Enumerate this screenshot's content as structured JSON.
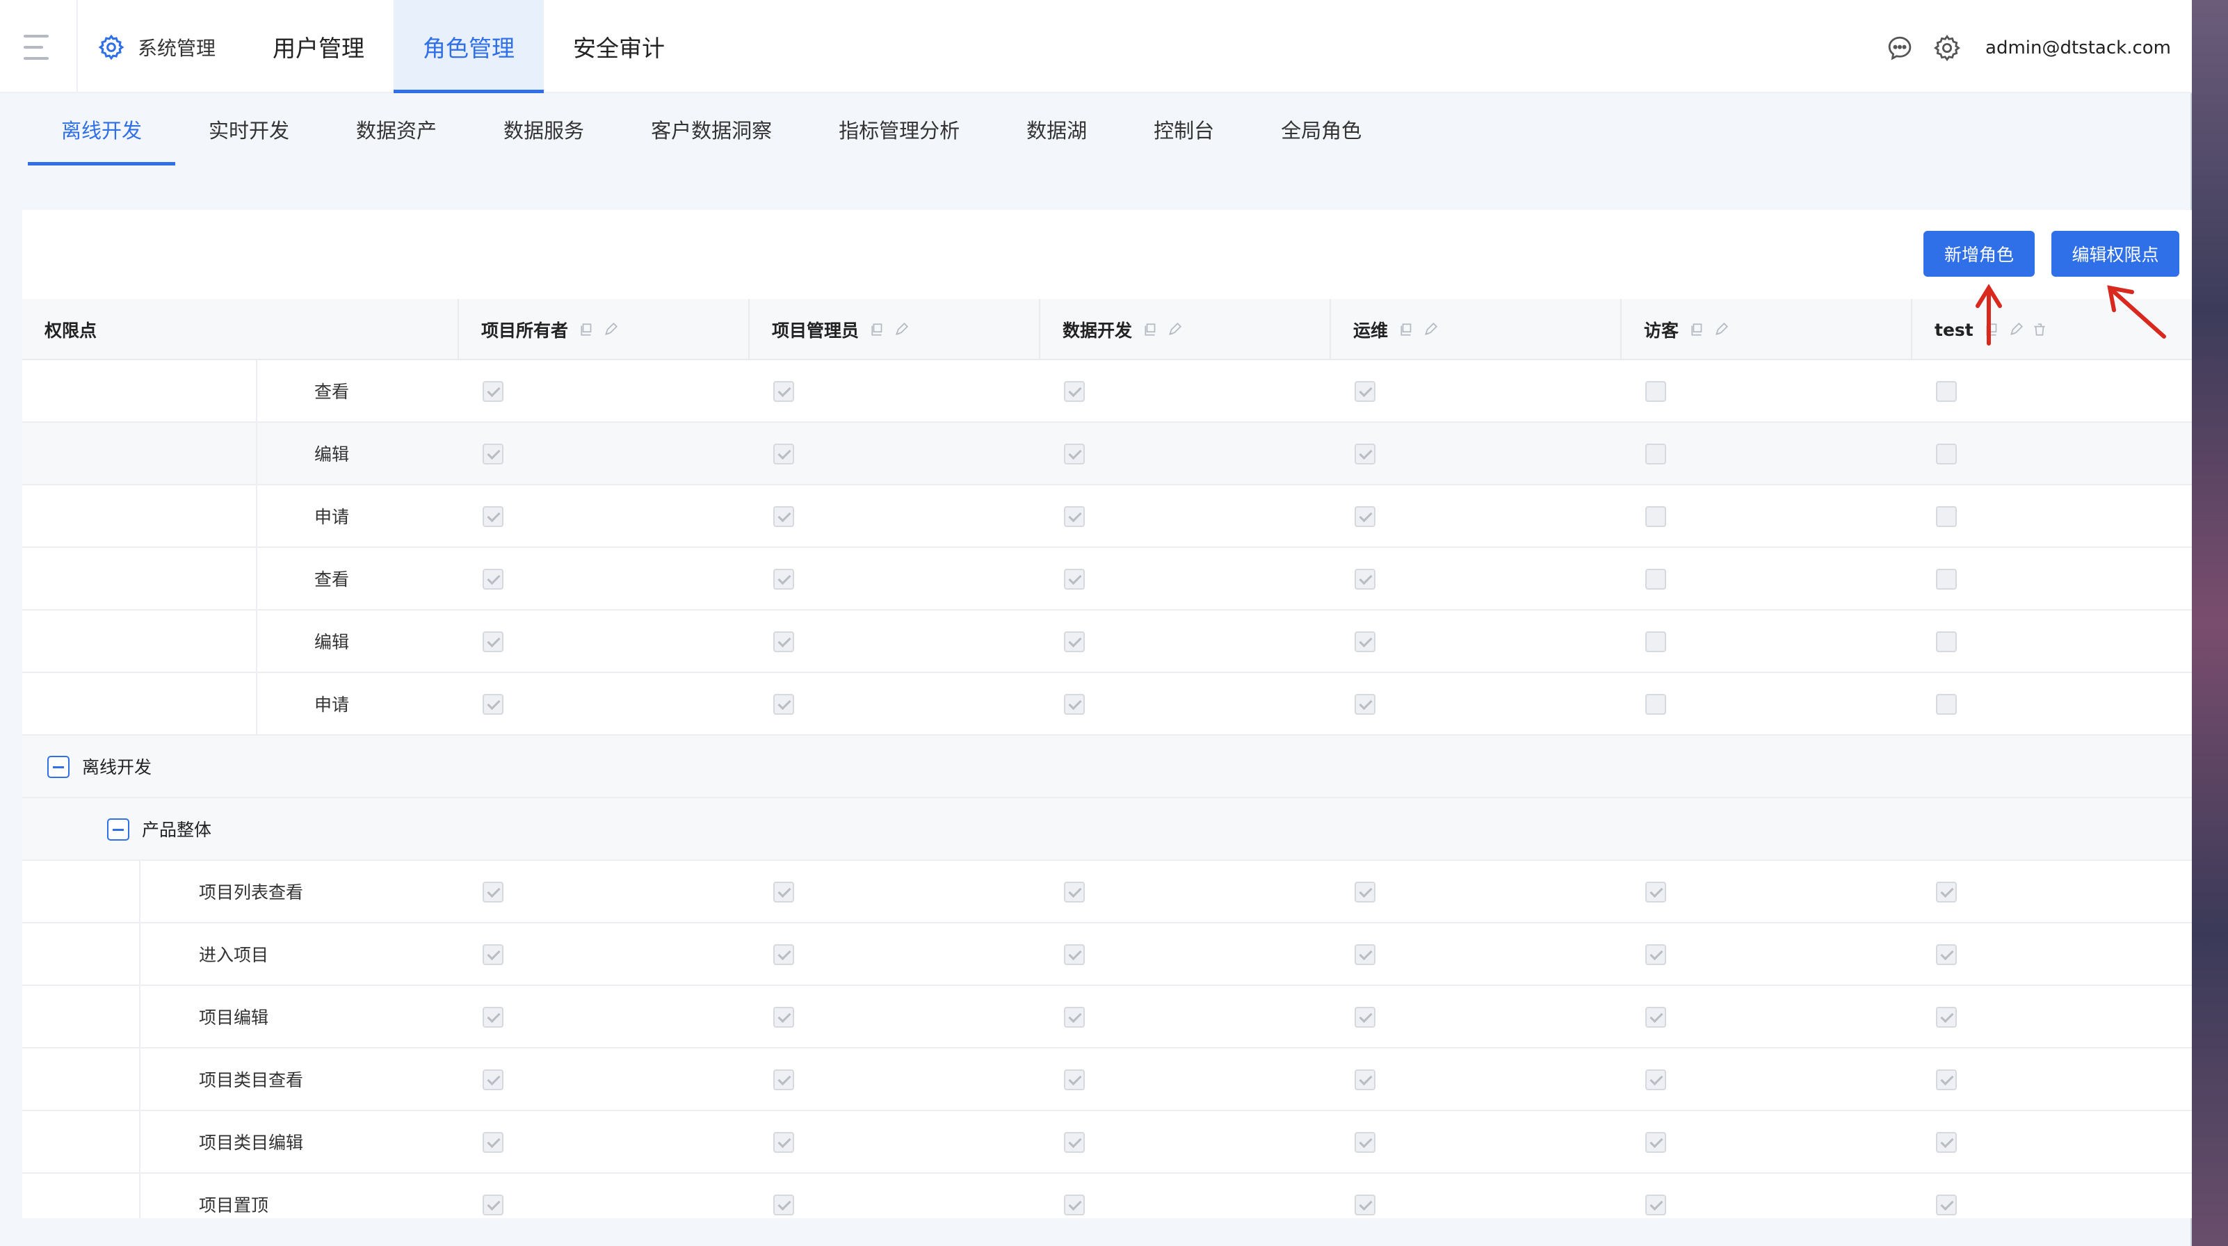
{
  "header": {
    "system_label": "系统管理",
    "nav": [
      "用户管理",
      "角色管理",
      "安全审计"
    ],
    "active_nav": 1,
    "user": "admin@dtstack.com"
  },
  "subtabs": {
    "items": [
      "离线开发",
      "实时开发",
      "数据资产",
      "数据服务",
      "客户数据洞察",
      "指标管理分析",
      "数据湖",
      "控制台",
      "全局角色"
    ],
    "active": 0
  },
  "toolbar": {
    "add_role": "新增角色",
    "edit_permissions": "编辑权限点"
  },
  "table": {
    "first_header": "权限点",
    "roles": [
      {
        "name": "项目所有者",
        "deletable": false
      },
      {
        "name": "项目管理员",
        "deletable": false
      },
      {
        "name": "数据开发",
        "deletable": false
      },
      {
        "name": "运维",
        "deletable": false
      },
      {
        "name": "访客",
        "deletable": false
      },
      {
        "name": "test",
        "deletable": true
      }
    ],
    "rows": [
      {
        "kind": "perm",
        "level": 3,
        "label": "查看",
        "checks": [
          true,
          true,
          true,
          true,
          false,
          false
        ],
        "alt": false
      },
      {
        "kind": "perm",
        "level": 3,
        "label": "编辑",
        "checks": [
          true,
          true,
          true,
          true,
          false,
          false
        ],
        "alt": true
      },
      {
        "kind": "perm",
        "level": 3,
        "label": "申请",
        "checks": [
          true,
          true,
          true,
          true,
          false,
          false
        ],
        "alt": false
      },
      {
        "kind": "perm",
        "level": 3,
        "label": "查看",
        "checks": [
          true,
          true,
          true,
          true,
          false,
          false
        ],
        "alt": false
      },
      {
        "kind": "perm",
        "level": 3,
        "label": "编辑",
        "checks": [
          true,
          true,
          true,
          true,
          false,
          false
        ],
        "alt": false
      },
      {
        "kind": "perm",
        "level": 3,
        "label": "申请",
        "checks": [
          true,
          true,
          true,
          true,
          false,
          false
        ],
        "alt": false
      },
      {
        "kind": "group",
        "level": 0,
        "label": "离线开发"
      },
      {
        "kind": "group",
        "level": 1,
        "label": "产品整体"
      },
      {
        "kind": "perm",
        "level": 2,
        "label": "项目列表查看",
        "checks": [
          true,
          true,
          true,
          true,
          true,
          true
        ],
        "alt": false
      },
      {
        "kind": "perm",
        "level": 2,
        "label": "进入项目",
        "checks": [
          true,
          true,
          true,
          true,
          true,
          true
        ],
        "alt": false
      },
      {
        "kind": "perm",
        "level": 2,
        "label": "项目编辑",
        "checks": [
          true,
          true,
          true,
          true,
          true,
          true
        ],
        "alt": false
      },
      {
        "kind": "perm",
        "level": 2,
        "label": "项目类目查看",
        "checks": [
          true,
          true,
          true,
          true,
          true,
          true
        ],
        "alt": false
      },
      {
        "kind": "perm",
        "level": 2,
        "label": "项目类目编辑",
        "checks": [
          true,
          true,
          true,
          true,
          true,
          true
        ],
        "alt": false
      },
      {
        "kind": "perm",
        "level": 2,
        "label": "项目置顶",
        "checks": [
          true,
          true,
          true,
          true,
          true,
          true
        ],
        "alt": false
      }
    ]
  },
  "colors": {
    "primary": "#2f6fe8",
    "annotation_arrow": "#d9281e"
  }
}
